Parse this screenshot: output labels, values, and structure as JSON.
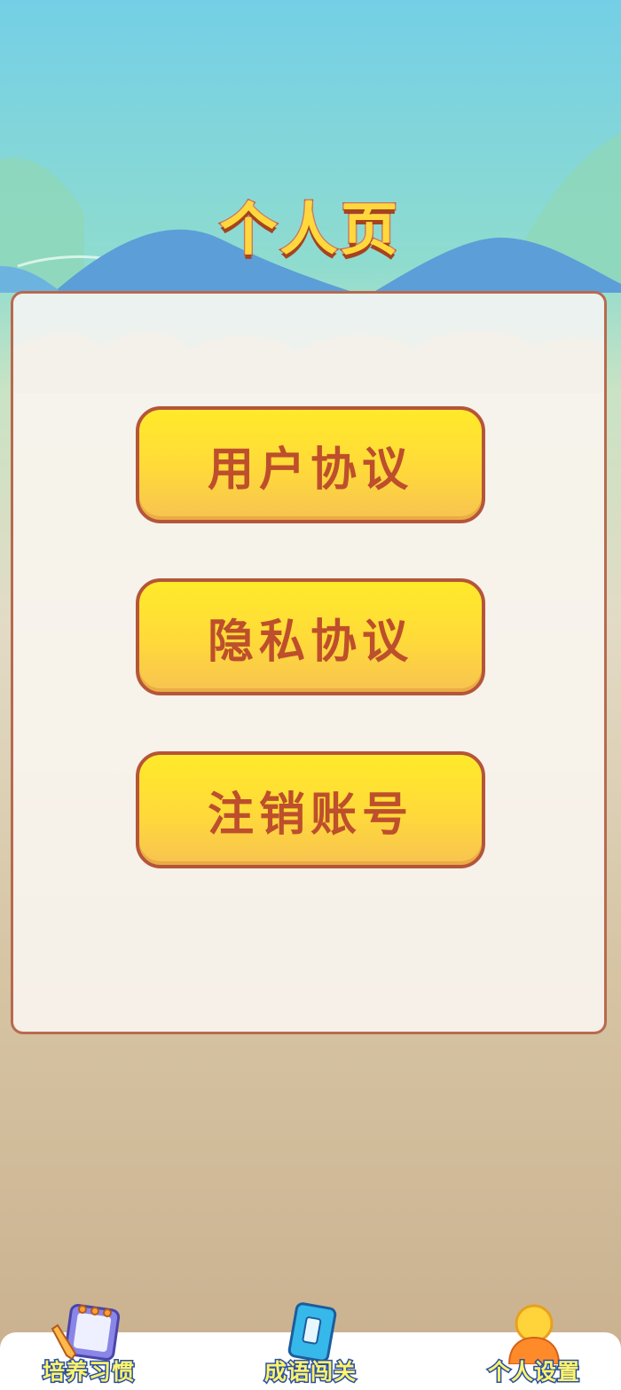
{
  "page": {
    "title": "个人页"
  },
  "menu": {
    "items": [
      {
        "label": "用户协议"
      },
      {
        "label": "隐私协议"
      },
      {
        "label": "注销账号"
      }
    ]
  },
  "tabbar": {
    "tabs": [
      {
        "label": "培养习惯",
        "icon": "notebook-pencil-icon"
      },
      {
        "label": "成语闯关",
        "icon": "book-icon"
      },
      {
        "label": "个人设置",
        "icon": "person-icon"
      }
    ]
  },
  "colors": {
    "button_fill": "#ffe22e",
    "button_border": "#b5553a",
    "button_text": "#bd4f2c",
    "title_fill": "#ffd93b",
    "title_stroke": "#c0542b",
    "tab_label_fill": "#fff36a",
    "tab_label_stroke": "#2a4fa5"
  }
}
